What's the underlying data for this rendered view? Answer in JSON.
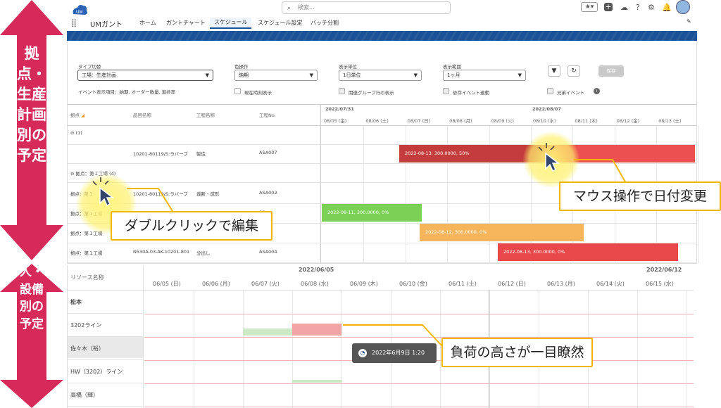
{
  "header": {
    "search_placeholder": "検索...",
    "app_name": "UMガント",
    "logo_text": "UM",
    "nav": [
      "ホーム",
      "ガントチャート",
      "スケジュール",
      "スケジュール設定",
      "バッチ分割"
    ],
    "active_tab": "スケジュール"
  },
  "filters": {
    "type_label": "タイプ切替",
    "type_value": "工場：生産計画",
    "color_label": "色操作",
    "color_value": "納期",
    "unit_label": "表示単位",
    "unit_value": "1日単位",
    "range_label": "表示範囲",
    "range_value": "1ヶ月",
    "event_items": "イベント表示項目：納期, オーダー数量, 進捗率",
    "chk_now": "現在時刻表示",
    "chk_group": "関連グループ行の表示",
    "chk_dep": "依存イベント連動",
    "chk_sibling": "兄弟イベント",
    "save": "保存"
  },
  "gantt": {
    "columns": [
      "拠点",
      "品目名称",
      "工程名称",
      "工程No."
    ],
    "date_groups": [
      "2022/07/31",
      "2022/08/07"
    ],
    "dates": [
      "08/05 (金)",
      "08/06 (土)",
      "08/07 (日)",
      "08/08 (月)",
      "08/09 (火)",
      "08/10 (水)",
      "08/11 (木)",
      "08/12 (金)",
      "08/13 (土)"
    ],
    "group1": "(1)",
    "row1": {
      "item": "10201-80119/S:ラバーブ",
      "process": "製造",
      "no": "ASA007"
    },
    "group2": "拠点：第１工場 (4)",
    "rows": [
      {
        "site": "拠点：第１",
        "item": "10201-80119/S:ラバーブ",
        "process": "裁断・成形",
        "no": "ASA002"
      },
      {
        "site": "拠点：第１工場",
        "item": "",
        "process": "",
        "no": "06"
      },
      {
        "site": "拠点：第１工場",
        "item": "",
        "process": "",
        "no": "05"
      },
      {
        "site": "拠点：第１工場",
        "item": "N530A-03-AK-10201-801",
        "process": "分出し",
        "no": "ASA004"
      }
    ],
    "bars": [
      {
        "label": "2022-08-13, 300.0000, 50%",
        "color": "#c43c3c"
      },
      {
        "label": "2022-08-11, 300.0000, 0%",
        "color": "#7bd155"
      },
      {
        "label": "2022-08-12, 300.0000, 0%",
        "color": "#f6b55a"
      },
      {
        "label": "2022-08-13, 300.0000, 0%",
        "color": "#e9484a"
      }
    ]
  },
  "resource": {
    "col_header": "リソース名称",
    "date_groups": [
      "2022/06/05",
      "2022/06/12"
    ],
    "dates": [
      "06/05 (日)",
      "06/06 (月)",
      "06/07 (火)",
      "06/08 (水)",
      "06/09 (木)",
      "06/10 (金)",
      "06/11 (土)",
      "06/12 (日)",
      "06/13 (月)",
      "06/14 (火)",
      "06/15 (水)"
    ],
    "names": [
      "松本",
      "3202ライン",
      "佐々木（裕）",
      "HW（3202）ライン",
      "高橋（輝）"
    ],
    "tooltip": "2022年6月9日 1:20"
  },
  "annotations": {
    "side_top": "拠点・生産計画別の予定",
    "side_bottom": "人・設備別の予定",
    "callout_mouse": "マウス操作で日付変更",
    "callout_dblclick": "ダブルクリックで編集",
    "callout_load": "負荷の高さが一目瞭然",
    "accent_color": "#d62a5b",
    "callout_border": "#f2b705"
  }
}
